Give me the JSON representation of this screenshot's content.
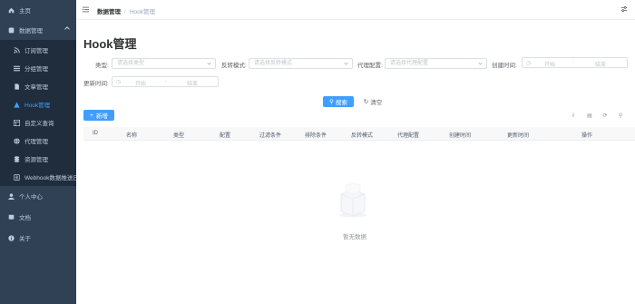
{
  "sidebar": {
    "home": "主页",
    "data_mgmt": "数据管理",
    "items": [
      "订阅管理",
      "分组管理",
      "文章管理",
      "Hook管理",
      "自定义查询",
      "代理管理",
      "资源管理",
      "Webhook数据推送日志"
    ],
    "profile": "个人中心",
    "docs": "文档",
    "about": "关于"
  },
  "navbar": {
    "breadcrumb_parent": "数据管理",
    "breadcrumb_sep": "/",
    "breadcrumb_current": "Hook管理"
  },
  "page_title": "Hook管理",
  "form": {
    "type_label": "类型:",
    "type_placeholder": "请选择类型",
    "reverse_label": "反转模式:",
    "reverse_placeholder": "请选择反转模式",
    "proxy_label": "代理配置:",
    "proxy_placeholder": "请选择代理配置",
    "created_label": "创建时间:",
    "created_start": "开始",
    "created_sep": "-",
    "created_end": "结束",
    "updated_label": "更新时间:",
    "updated_start": "开始",
    "updated_sep": "-",
    "updated_end": "结束",
    "search_btn": "搜索",
    "reset_btn": "清空"
  },
  "toolbar": {
    "add_btn": "新增"
  },
  "table": {
    "columns": [
      "ID",
      "名称",
      "类型",
      "配置",
      "过滤条件",
      "排除条件",
      "反转模式",
      "代理配置",
      "创建时间",
      "更新时间",
      "操作"
    ],
    "empty_text": "暂无数据"
  },
  "colors": {
    "sidebar_bg": "#304156",
    "submenu_bg": "#1f2d3d",
    "active": "#409eff",
    "primary": "#409eff"
  }
}
